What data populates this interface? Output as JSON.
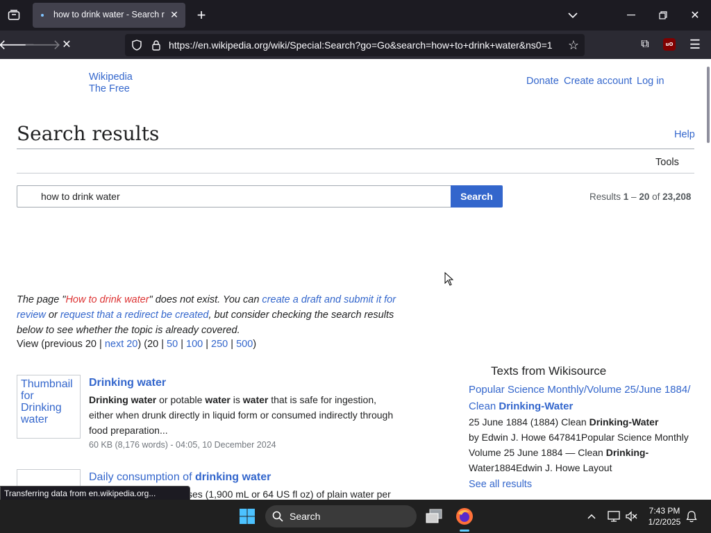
{
  "browser": {
    "tab_title": "how to drink water - Search results",
    "url": "https://en.wikipedia.org/wiki/Special:Search?go=Go&search=how+to+drink+water&ns0=1",
    "status": "Transferring data from en.wikipedia.org..."
  },
  "wiki": {
    "logo_line1": "Wikipedia",
    "logo_line2": "The Free",
    "donate": "Donate",
    "create_account": "Create account",
    "log_in": "Log in",
    "page_title": "Search results",
    "help": "Help",
    "tools": "Tools",
    "search_value": "how to drink water",
    "search_button": "Search",
    "results_prefix": "Results ",
    "results_from": "1",
    "results_dash": " – ",
    "results_to": "20",
    "results_of": " of ",
    "results_total": "23,208",
    "notice": {
      "p1": "The page \"",
      "missing_link": "How to drink water",
      "p2": "\" does not exist. You can ",
      "draft_link": "create a draft and submit it for review",
      "p3": " or ",
      "redirect_link": "request that a redirect be created",
      "p4": ", but consider checking the search results below to see whether the topic is already covered."
    },
    "view": {
      "prefix": "View (previous 20 | ",
      "next": "next 20",
      "mid": ") (20 | ",
      "n50": "50",
      "n100": "100",
      "n250": "250",
      "n500": "500",
      "sep": " | ",
      "end": ")"
    },
    "results": [
      {
        "thumb": "Thumbnail for Drinking water",
        "title": "Drinking water",
        "snippet_html_parts": [
          "Drinking",
          " ",
          "water",
          " or potable ",
          "water",
          " is ",
          "water",
          " that is safe for ingestion, either when drunk directly in liquid form or consumed indirectly through food preparation..."
        ],
        "meta": "60 KB (8,176 words) - 04:05, 10 December 2024"
      },
      {
        "title_a": "Daily consumption of ",
        "title_b": "drinking water",
        "snippet": "ses (1,900 mL or 64 US fl oz) of plain water per"
      }
    ],
    "sidebar": {
      "heading": "Texts from Wikisource",
      "link_a": "Popular Science Monthly/Volume 25/June 1884/",
      "link_b": "Clean ",
      "link_c": "Drinking-Water",
      "text1": "25 June 1884 (1884) Clean ",
      "text1b": "Drinking-Water",
      "text2": "by Edwin J. Howe 647841Popular Science Monthly",
      "text3": "Volume 25 June 1884 — Clean ",
      "text3b": "Drinking-",
      "text4": "Water1884Edwin J. Howe Layout",
      "see_all": "See all results"
    }
  },
  "taskbar": {
    "search": "Search",
    "time": "7:43 PM",
    "date": "1/2/2025"
  }
}
